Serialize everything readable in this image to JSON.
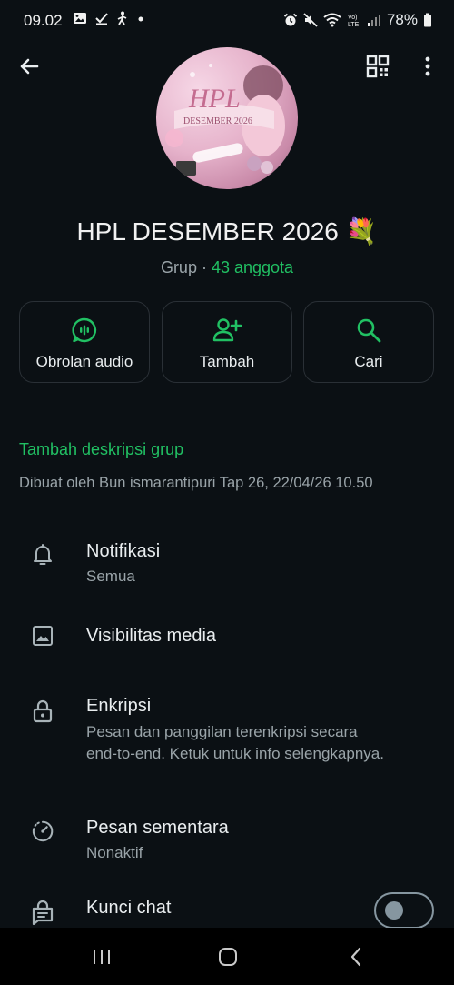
{
  "status_bar": {
    "time": "09.02",
    "battery": "78%",
    "left_icons": [
      "image-icon",
      "download-done-icon",
      "walking-icon",
      "dot-icon"
    ],
    "right_icons": [
      "alarm-icon",
      "mute-icon",
      "wifi-icon",
      "volte-icon",
      "signal-icon",
      "battery-icon"
    ]
  },
  "header": {
    "back_icon": "arrow-left-icon",
    "qr_icon": "qr-code-icon",
    "menu_icon": "more-vertical-icon"
  },
  "group": {
    "avatar_text": "HPL",
    "avatar_subtext": "DESEMBER 2026",
    "title": "HPL DESEMBER 2026",
    "emoji": "💐",
    "sub_prefix": "Grup · ",
    "member_count": "43 anggota"
  },
  "actions": [
    {
      "label": "Obrolan audio",
      "icon": "audio-chat-icon"
    },
    {
      "label": "Tambah",
      "icon": "add-person-icon"
    },
    {
      "label": "Cari",
      "icon": "search-icon"
    }
  ],
  "description": {
    "add_label": "Tambah deskripsi grup",
    "created_by": "Dibuat oleh Bun ismarantipuri Tap 26, 22/04/26 10.50"
  },
  "settings": [
    {
      "title": "Notifikasi",
      "subtitle": "Semua",
      "icon": "bell-icon"
    },
    {
      "title": "Visibilitas media",
      "subtitle": "",
      "icon": "image-icon"
    },
    {
      "title": "Enkripsi",
      "subtitle": "Pesan dan panggilan terenkripsi secara end-to-end. Ketuk untuk info selengkapnya.",
      "icon": "lock-icon"
    },
    {
      "title": "Pesan sementara",
      "subtitle": "Nonaktif",
      "icon": "timer-icon"
    },
    {
      "title": "Kunci chat",
      "subtitle": "",
      "icon": "chat-lock-icon",
      "toggle_on": false
    }
  ],
  "colors": {
    "background": "#0b1014",
    "accent_green": "#21c063",
    "secondary_text": "#9aa4a9"
  }
}
